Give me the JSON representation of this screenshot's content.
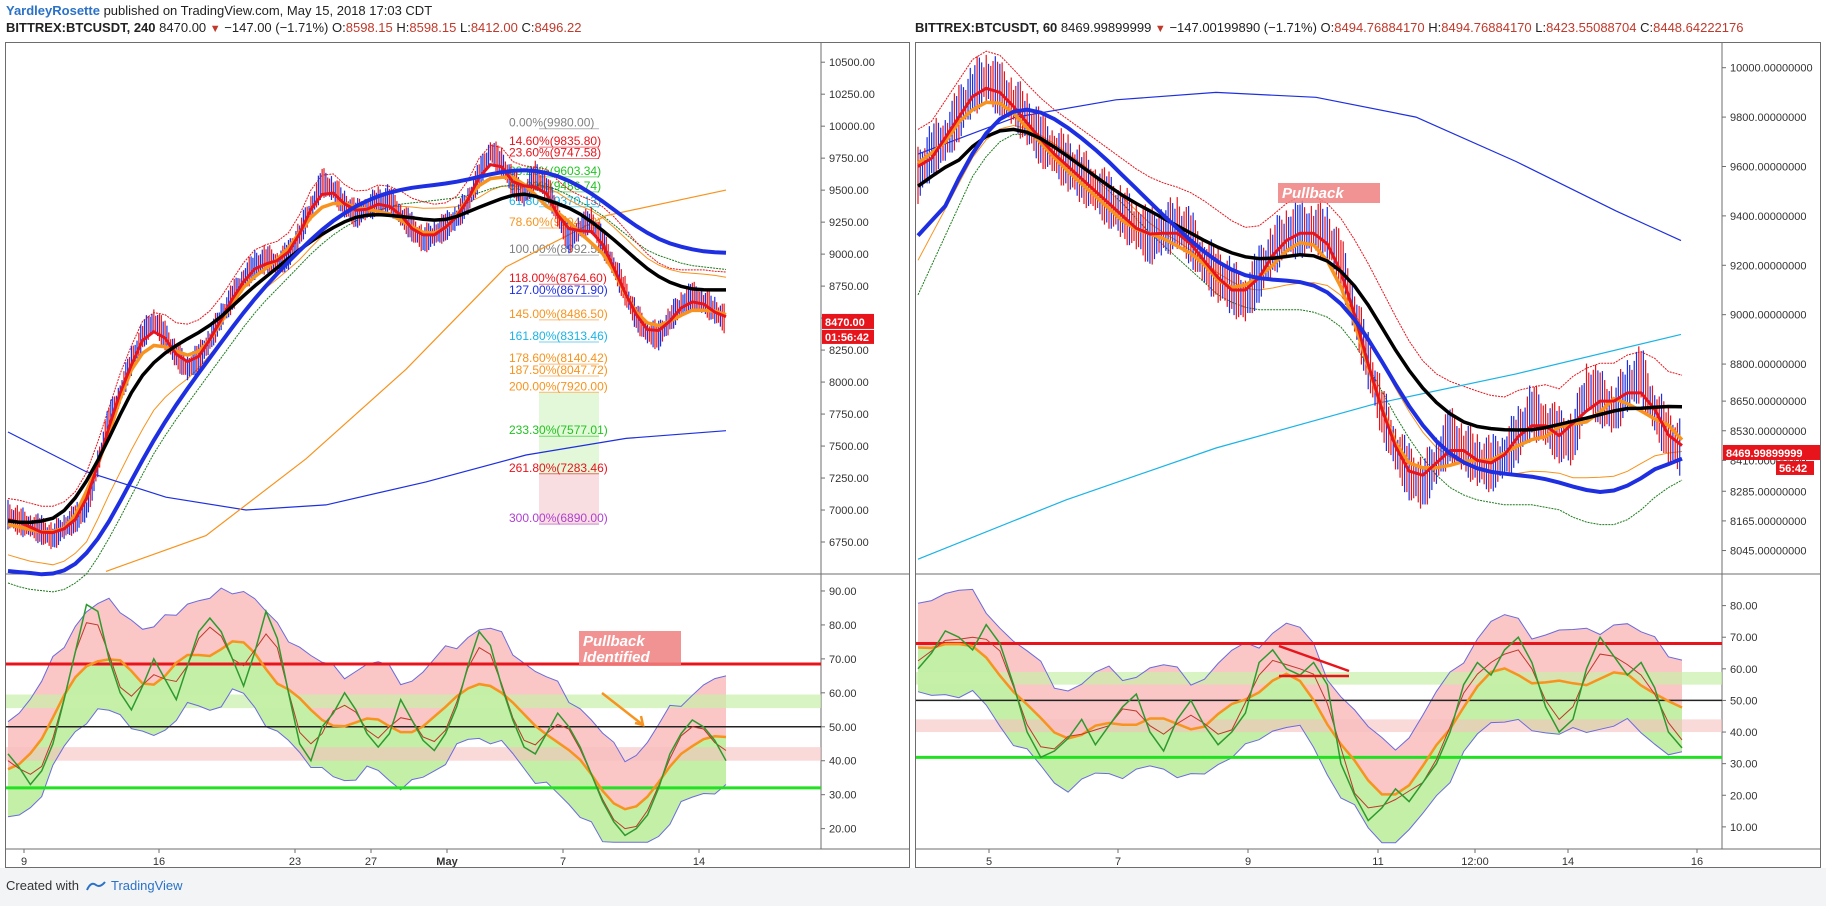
{
  "header": {
    "author": "YardleyRosette",
    "published_text": "published on TradingView.com, May 15, 2018 17:03 CDT"
  },
  "footer": {
    "created_with": "Created with",
    "brand": "TradingView"
  },
  "colors": {
    "red": "#e8141c",
    "orange": "#f7931e",
    "black": "#000000",
    "blue": "#1d2fe0",
    "green": "#1a7a1a",
    "cyan": "#1ab3e6",
    "rsi_green": "#2e9a2e",
    "bull_fill": "#9be56a",
    "bear_fill": "#f7a0a0",
    "bright_green": "#22e022"
  },
  "left": {
    "symbol": "BITTREX:BTCUSDT, 240",
    "last": "8470.00",
    "change": "−147.00 (−1.71%)",
    "o": "O:",
    "o_val": "8598.15",
    "h": "H:",
    "h_val": "8598.15",
    "l": "L:",
    "l_val": "8412.00",
    "c": "C:",
    "c_val": "8496.22",
    "price_badge": "8470.00",
    "time_badge": "01:56:42",
    "chart_data": {
      "type": "line",
      "ylim": [
        6500,
        10650
      ],
      "y_ticks": [
        "10500.00",
        "10250.00",
        "10000.00",
        "9750.00",
        "9500.00",
        "9250.00",
        "9000.00",
        "8750.00",
        "8500.00",
        "8250.00",
        "8000.00",
        "7750.00",
        "7500.00",
        "7250.00",
        "7000.00",
        "6750.00",
        "6500.00"
      ],
      "x_ticks": [
        "9",
        "16",
        "23",
        "27",
        "May",
        "7",
        "14"
      ],
      "fib_levels": [
        {
          "label": "0.00%(9980.00)",
          "value": 9980,
          "color": "#7f7f7f"
        },
        {
          "label": "14.60%(9835.80)",
          "value": 9835.8,
          "color": "#e8141c"
        },
        {
          "label": "23.60%(9747.58)",
          "value": 9747.58,
          "color": "#e8141c"
        },
        {
          "label": "38.20%(9603.34)",
          "value": 9603.34,
          "color": "#22c222"
        },
        {
          "label": "50.00%(9486.74)",
          "value": 9486.74,
          "color": "#22c222"
        },
        {
          "label": "61.80%(9370.13)",
          "value": 9370.13,
          "color": "#1ab3e6"
        },
        {
          "label": "78.60%(9204.12)",
          "value": 9204.12,
          "color": "#f7931e"
        },
        {
          "label": "100.00%(8992.52)",
          "value": 8992.52,
          "color": "#7f7f7f"
        },
        {
          "label": "118.00%(8764.60)",
          "value": 8764.6,
          "color": "#e8141c"
        },
        {
          "label": "127.00%(8671.90)",
          "value": 8671.9,
          "color": "#1d2fe0"
        },
        {
          "label": "145.00%(8486.50)",
          "value": 8486.5,
          "color": "#f7931e"
        },
        {
          "label": "161.80%(8313.46)",
          "value": 8313.46,
          "color": "#1ab3e6"
        },
        {
          "label": "178.60%(8140.42)",
          "value": 8140.42,
          "color": "#f7931e"
        },
        {
          "label": "187.50%(8047.72)",
          "value": 8047.72,
          "color": "#f7931e"
        },
        {
          "label": "200.00%(7920.00)",
          "value": 7920,
          "color": "#f7931e"
        },
        {
          "label": "233.30%(7577.01)",
          "value": 7577.01,
          "color": "#22c222"
        },
        {
          "label": "261.80%(7283.46)",
          "value": 7283.46,
          "color": "#e8141c"
        },
        {
          "label": "300.00%(6890.00)",
          "value": 6890,
          "color": "#b03fd0"
        }
      ],
      "price": [
        6950,
        6900,
        6870,
        6830,
        6780,
        6860,
        6920,
        7000,
        7350,
        7700,
        7900,
        8150,
        8350,
        8480,
        8350,
        8200,
        8100,
        8180,
        8320,
        8500,
        8650,
        8800,
        8900,
        8950,
        8920,
        8980,
        9150,
        9350,
        9550,
        9500,
        9380,
        9300,
        9350,
        9400,
        9420,
        9300,
        9200,
        9100,
        9150,
        9200,
        9280,
        9400,
        9600,
        9800,
        9700,
        9550,
        9450,
        9600,
        9520,
        9300,
        9100,
        9200,
        9250,
        9080,
        8900,
        8700,
        8500,
        8380,
        8350,
        8480,
        8600,
        8660,
        8620,
        8550,
        8470
      ],
      "ema_black": [
        6950,
        6930,
        6900,
        6880,
        6860,
        6900,
        6980,
        7100,
        7350,
        7600,
        7800,
        7980,
        8130,
        8260,
        8300,
        8300,
        8290,
        8320,
        8400,
        8500,
        8600,
        8700,
        8780,
        8850,
        8890,
        8940,
        9000,
        9100,
        9200,
        9260,
        9290,
        9300,
        9300,
        9320,
        9340,
        9320,
        9290,
        9250,
        9240,
        9230,
        9240,
        9290,
        9360,
        9450,
        9500,
        9490,
        9470,
        9480,
        9470,
        9420,
        9340,
        9300,
        9280,
        9230,
        9150,
        9050,
        8940,
        8840,
        8770,
        8730,
        8720,
        8730,
        8730,
        8720,
        8700
      ],
      "ema_blue": [
        6550,
        6520,
        6500,
        6490,
        6480,
        6500,
        6550,
        6620,
        6750,
        6900,
        7060,
        7230,
        7400,
        7560,
        7700,
        7830,
        7950,
        8070,
        8190,
        8310,
        8430,
        8550,
        8660,
        8760,
        8850,
        8940,
        9030,
        9120,
        9200,
        9270,
        9330,
        9380,
        9420,
        9460,
        9490,
        9510,
        9520,
        9530,
        9540,
        9550,
        9560,
        9580,
        9600,
        9630,
        9650,
        9660,
        9660,
        9660,
        9650,
        9620,
        9580,
        9530,
        9480,
        9420,
        9350,
        9280,
        9210,
        9150,
        9110,
        9080,
        9050,
        9030,
        9020,
        9010,
        9000
      ],
      "rsi_ylim": [
        14,
        95
      ],
      "rsi_y_ticks": [
        "90.00",
        "80.00",
        "70.00",
        "60.00",
        "50.00",
        "40.00",
        "30.00",
        "20.00"
      ],
      "rsi_levels": {
        "upper": 68.5,
        "mid": 50,
        "lower": 32
      },
      "rsi": [
        42,
        38,
        33,
        37,
        45,
        58,
        72,
        86,
        84,
        70,
        60,
        55,
        62,
        70,
        64,
        58,
        68,
        78,
        82,
        78,
        70,
        62,
        72,
        84,
        76,
        60,
        45,
        40,
        50,
        54,
        60,
        55,
        48,
        44,
        48,
        58,
        52,
        46,
        43,
        48,
        56,
        68,
        78,
        74,
        62,
        52,
        44,
        42,
        48,
        54,
        50,
        44,
        36,
        28,
        22,
        18,
        20,
        24,
        32,
        42,
        48,
        52,
        50,
        46,
        40
      ],
      "annotation": "Pullback\nIdentified"
    }
  },
  "right": {
    "symbol": "BITTREX:BTCUSDT, 60",
    "last": "8469.99899999",
    "change": "−147.00199890 (−1.71%)",
    "o": "O:",
    "o_val": "8494.76884170",
    "h": "H:",
    "h_val": "8494.76884170",
    "l": "L:",
    "l_val": "8423.55088704",
    "c": "C:",
    "c_val": "8448.64222176",
    "price_badge": "8469.99899999",
    "time_badge": "56:42",
    "chart_data": {
      "type": "line",
      "ylim": [
        7950,
        10100
      ],
      "y_ticks": [
        "10000.00000000",
        "9800.00000000",
        "9600.00000000",
        "9400.00000000",
        "9200.00000000",
        "9000.00000000",
        "8800.00000000",
        "8650.00000000",
        "8530.00000000",
        "8410.00000000",
        "8285.00000000",
        "8165.00000000",
        "8045.00000000"
      ],
      "x_ticks": [
        "5",
        "7",
        "9",
        "11",
        "12:00",
        "14",
        "16"
      ],
      "price": [
        9550,
        9650,
        9700,
        9800,
        9900,
        9950,
        9900,
        9850,
        9780,
        9700,
        9650,
        9600,
        9550,
        9500,
        9450,
        9400,
        9350,
        9300,
        9330,
        9360,
        9300,
        9200,
        9150,
        9100,
        9050,
        9150,
        9250,
        9320,
        9330,
        9340,
        9320,
        9200,
        9000,
        8800,
        8600,
        8450,
        8350,
        8300,
        8400,
        8500,
        8450,
        8400,
        8380,
        8420,
        8500,
        8600,
        8550,
        8500,
        8480,
        8700,
        8650,
        8600,
        8700,
        8750,
        8600,
        8500,
        8440
      ],
      "ema_black": [
        9400,
        9480,
        9560,
        9640,
        9720,
        9780,
        9800,
        9790,
        9760,
        9720,
        9680,
        9640,
        9600,
        9560,
        9520,
        9480,
        9440,
        9400,
        9380,
        9370,
        9350,
        9310,
        9270,
        9230,
        9190,
        9190,
        9210,
        9240,
        9260,
        9280,
        9280,
        9240,
        9160,
        9060,
        8950,
        8840,
        8740,
        8650,
        8600,
        8580,
        8560,
        8540,
        8520,
        8510,
        8520,
        8540,
        8550,
        8550,
        8550,
        8580,
        8600,
        8610,
        8630,
        8650,
        8650,
        8620,
        8590
      ],
      "ema_blue": [
        9200,
        9320,
        9440,
        9560,
        9680,
        9760,
        9820,
        9850,
        9850,
        9830,
        9800,
        9760,
        9720,
        9670,
        9620,
        9570,
        9510,
        9450,
        9400,
        9350,
        9300,
        9250,
        9200,
        9170,
        9150,
        9140,
        9140,
        9140,
        9140,
        9130,
        9110,
        9070,
        9000,
        8910,
        8810,
        8710,
        8620,
        8540,
        8470,
        8420,
        8390,
        8370,
        8360,
        8350,
        8350,
        8350,
        8340,
        8330,
        8300,
        8280,
        8270,
        8270,
        8290,
        8330,
        8380,
        8420,
        8450
      ],
      "rsi_ylim": [
        3,
        90
      ],
      "rsi_y_ticks": [
        "80.00",
        "70.00",
        "60.00",
        "50.00",
        "40.00",
        "30.00",
        "20.00",
        "10.00"
      ],
      "rsi_levels": {
        "upper": 68,
        "mid": 50,
        "lower": 32
      },
      "rsi": [
        60,
        65,
        72,
        70,
        66,
        74,
        68,
        55,
        40,
        32,
        34,
        38,
        44,
        36,
        42,
        48,
        52,
        40,
        34,
        44,
        50,
        42,
        36,
        40,
        46,
        62,
        66,
        60,
        58,
        62,
        55,
        30,
        20,
        12,
        16,
        22,
        18,
        24,
        30,
        40,
        55,
        62,
        58,
        66,
        70,
        62,
        48,
        40,
        44,
        60,
        70,
        64,
        58,
        62,
        54,
        40,
        35
      ],
      "annotation": "Pullback"
    }
  }
}
